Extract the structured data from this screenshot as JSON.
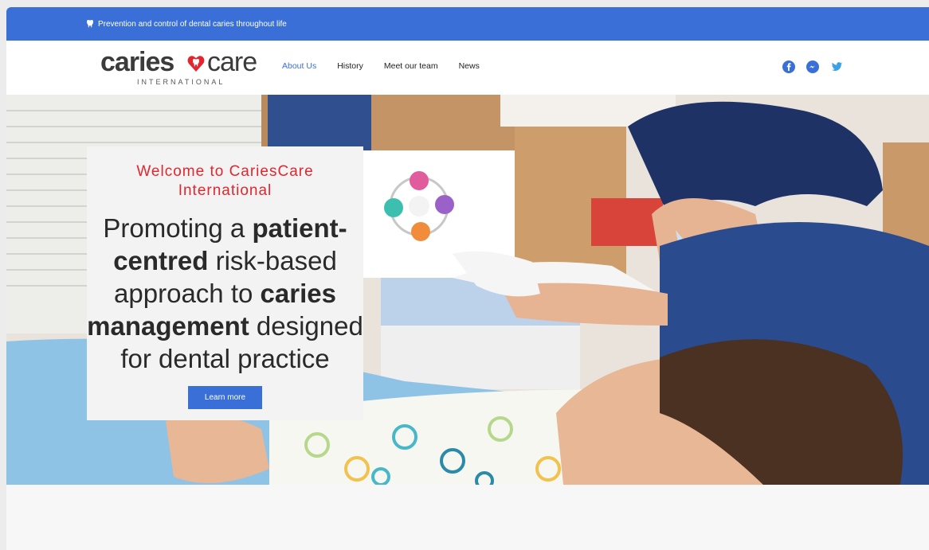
{
  "topbar": {
    "text": "Prevention and control of dental caries throughout life",
    "icon": "tooth-icon"
  },
  "logo": {
    "word1": "caries",
    "word2": "care",
    "subtitle": "INTERNATIONAL"
  },
  "nav": {
    "items": [
      "About Us",
      "History",
      "Meet our team",
      "News"
    ],
    "active": "About Us"
  },
  "social": [
    "facebook-icon",
    "messenger-icon",
    "twitter-icon"
  ],
  "hero": {
    "welcome": "Welcome to CariesCare International",
    "headline_parts": [
      {
        "text": "Promoting a ",
        "bold": false
      },
      {
        "text": "patient-centred",
        "bold": true
      },
      {
        "text": " risk-based approach to ",
        "bold": false
      },
      {
        "text": "caries management",
        "bold": true
      },
      {
        "text": " designed for dental practice",
        "bold": false
      }
    ],
    "button": "Learn more"
  },
  "colors": {
    "brand_blue": "#3a6fd8",
    "accent_red": "#e3262e"
  }
}
